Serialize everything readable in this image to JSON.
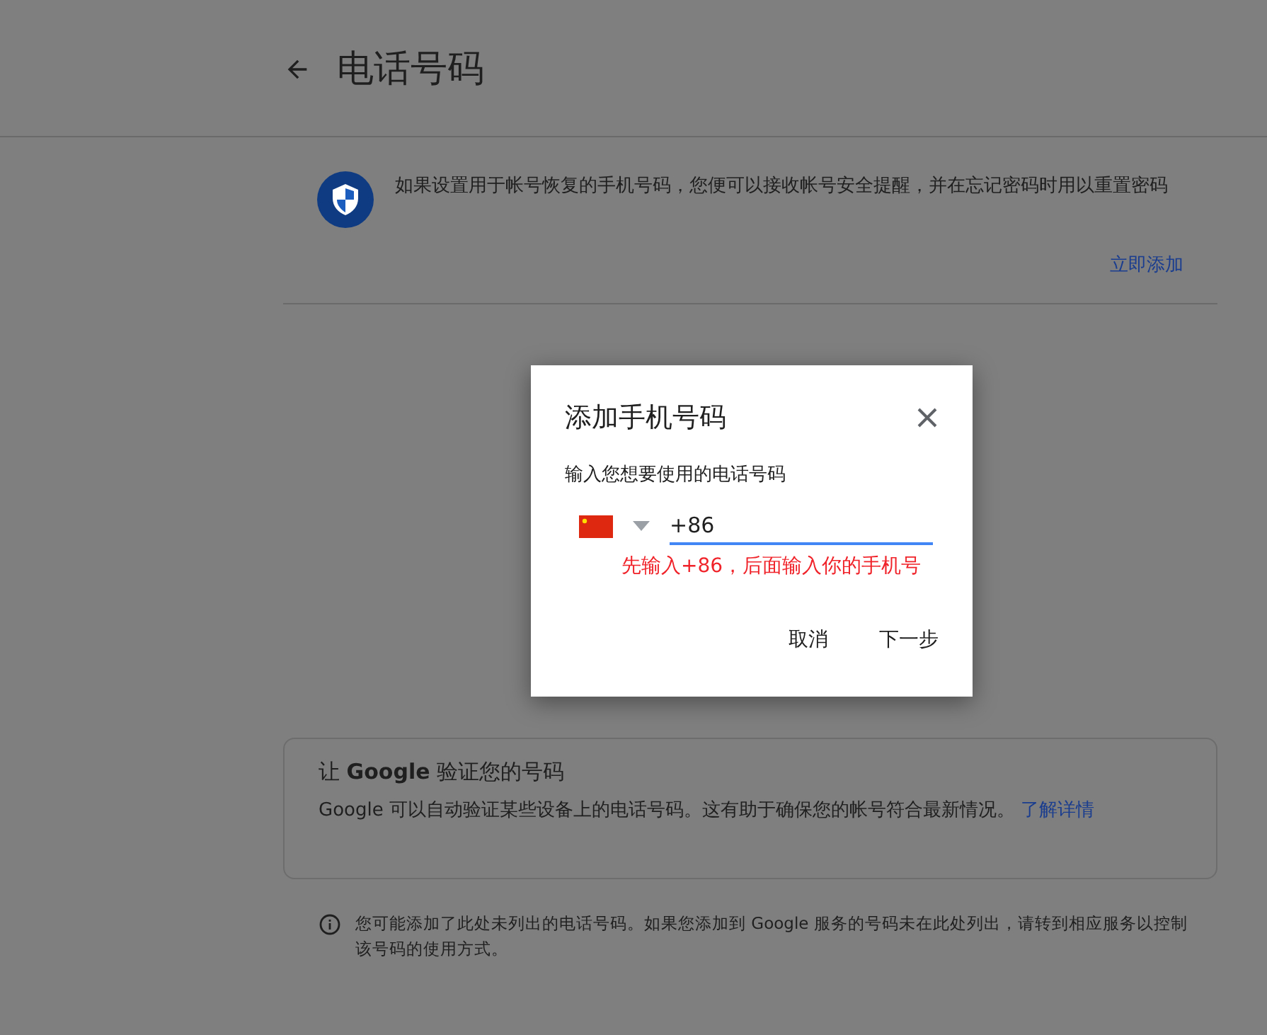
{
  "header": {
    "title": "电话号码"
  },
  "recovery": {
    "text": "如果设置用于帐号恢复的手机号码，您便可以接收帐号安全提醒，并在忘记密码时用以重置密码",
    "action": "立即添加"
  },
  "verify_card": {
    "title": "让 **Google** 验证您的号码",
    "text": "Google 可以自动验证某些设备上的电话号码。这有助于确保您的帐号符合最新情况。",
    "link": "了解详情"
  },
  "notice": {
    "text": "您可能添加了此处未列出的电话号码。如果您添加到 Google 服务的号码未在此处列出，请转到相应服务以控制该号码的使用方式。"
  },
  "dialog": {
    "title": "添加手机号码",
    "prompt": "输入您想要使用的电话号码",
    "phone": {
      "value": "+86"
    },
    "annotation": "先输入+86，后面输入你的手机号",
    "buttons": [
      "取消",
      "下一步"
    ]
  }
}
